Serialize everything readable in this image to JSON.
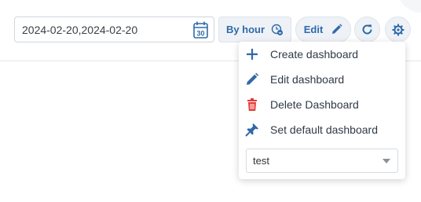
{
  "toolbar": {
    "date_range": "2024-02-20,2024-02-20",
    "calendar_day": "30",
    "granularity_label": "By hour",
    "edit_label": "Edit"
  },
  "menu": {
    "items": [
      {
        "label": "Create dashboard",
        "icon": "plus-icon"
      },
      {
        "label": "Edit dashboard",
        "icon": "pencil-icon"
      },
      {
        "label": "Delete Dashboard",
        "icon": "trash-icon"
      },
      {
        "label": "Set default dashboard",
        "icon": "pin-icon"
      }
    ],
    "dashboard_select": {
      "value": "test"
    }
  },
  "colors": {
    "accent": "#2f6aa8",
    "danger": "#e53935",
    "button_bg": "#eef2f7"
  }
}
